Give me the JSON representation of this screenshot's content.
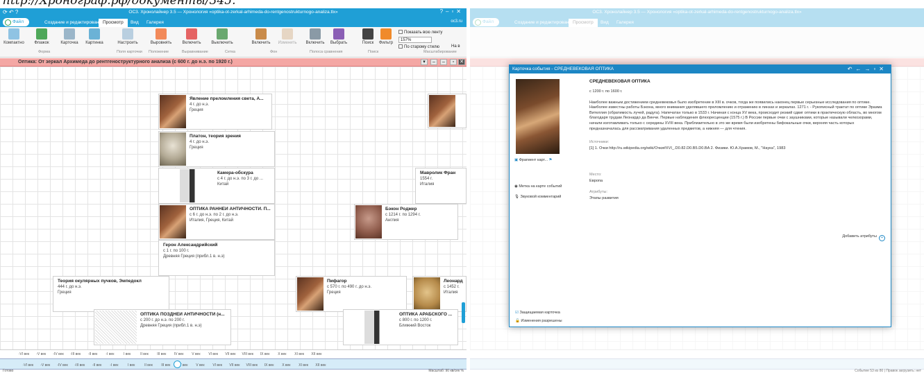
{
  "caption": "http://Хронограф.рф/документы/345.",
  "app": {
    "title": "ОС3. Хронолайнер 3.5 — Хронология «optika-ot-zerkal-arhimeda-do-rentgenostrukturnogo-analiza.tlx»",
    "site": "oc3.ru",
    "tabs": [
      "Файл",
      "Создание и редактирование",
      "Просмотр",
      "Вид",
      "Галерея"
    ],
    "active_tab": "Просмотр"
  },
  "ribbon": {
    "buttons": [
      "Компактно",
      "Флажок",
      "Карточка",
      "Картинка",
      "Настроить",
      "Выровнять",
      "Включить",
      "Выключить",
      "Включить",
      "Изменить",
      "Включить",
      "Выбрать",
      "Поиск",
      "Фильтр"
    ],
    "groups": [
      "Форма",
      "Поля карточки",
      "Положение",
      "Выравнивание",
      "Сетка",
      "Фон",
      "Полоса сравнения",
      "Поиск",
      "Масштабирование"
    ],
    "show_all_label": "Показать всю ленту",
    "zoom_value": "157%",
    "old_style_label": "По старому стилю",
    "to_label": "На в"
  },
  "timeline": {
    "title": "Оптика: От зеркал Архимеда до рентгеноструктурного анализа (с 600 г. до н.э. по 1920 г.)",
    "centuries": [
      "-VI век",
      "-V век",
      "-IV век",
      "-III век",
      "-II век",
      "-I век",
      "I век",
      "II век",
      "III век",
      "IV век",
      "V век",
      "VI век",
      "VII век",
      "VIII век",
      "IX век",
      "X век",
      "XI век",
      "XII век"
    ],
    "status_left": "Готово",
    "status_right": "Масштаб: 90 кв/сек %"
  },
  "cards": [
    {
      "title": "Явление преломления света, А...",
      "date": "4 г. до н.э.",
      "place": "Греция"
    },
    {
      "title": "Платон, теория зрения",
      "date": "4 г. до н.э.",
      "place": "Греция"
    },
    {
      "title": "Камера-обскура",
      "date": "с 4 г. до н.э. по 3 г. до ...",
      "place": "Китай"
    },
    {
      "title": "Мавролик Фран",
      "date": "1554 г.",
      "place": "Италия"
    },
    {
      "title": "ОПТИКА РАННЕЙ АНТИЧНОСТИ. П...",
      "date": "с 6 г. до н.э. по 2 г. до н.э.",
      "place": "Италия, Греция, Китай"
    },
    {
      "title": "Бэкон Роджер",
      "date": "с 1214 г. по 1294 г.",
      "place": "Англия"
    },
    {
      "title": "Герон Александрийский",
      "date": "с 1 г. по 100 г.",
      "place": "Древняя Греция (прибл.1 в. н.э)"
    },
    {
      "title": "Теория окулярных пучков, Эмпедокл",
      "date": "444 г. до н.э.",
      "place": "Греция"
    },
    {
      "title": "Пифагор",
      "date": "с 570 г. по 490 г. до н.э.",
      "place": "Греция"
    },
    {
      "title": "Леонард",
      "date": "с 1452 г.",
      "place": "Италия"
    },
    {
      "title": "ОПТИКА ПОЗДНЕЙ АНТИЧНОСТИ (н...",
      "date": "с 200 г. до н.э. по 200 г.",
      "place": "Древняя Греция (прибл.1 в. н.э)"
    },
    {
      "title": "ОПТИКА АРАБСКОГО ...",
      "date": "с 800 г. по 1200 г.",
      "place": "Ближний Восток"
    }
  ],
  "dialog": {
    "title": "Карточка события - СРЕДНЕВЕКОВАЯ ОПТИКА",
    "heading": "СРЕДНЕВЕКОВАЯ ОПТИКА",
    "dates": "с 1200 г. по 1600 г.",
    "body": "Наиболее важным достижением средневековья было изобретение в XIII в. очков, тогда же появились наконец первые серьезные исследования по оптике. Наиболее известны работы Бэкона, много внимания уделявшего преломлению и отражению в линзах и зеркалах. 1271 г. - Рукописный трактат по оптике Эразма Вителлия (обратимость лучей, радуга). Напечатан только в 1533 г. Начиная с конца XV века, происходит резкий сдвиг оптики в практическую область, во многом благодаря трудам Леонардо да Винчи. Первые наблюдения флюоресценции (1575 г.) В России первые очки с заушниками, которые называли челкозорами, начали изготавливать только с середины XVIII века. Приблизительно в это же время были изобретены бифокальные очки, верхняя часть которых предназначалась для рассматривания удаленных предметов, а нижняя — для чтения.",
    "sources_label": "Источники:",
    "source": "[1]   1. Очки http://ru.wikipedia.org/wiki/Очки#XVI_.D0.82.D0.B5.D0.BA 2. Физики. Ю.А.Храмов, М., \"Наука\", 1983",
    "place_label": "Место:",
    "place": "Европа",
    "attrs_label": "Атрибуты:",
    "attr_value": "Этапы развития",
    "add_attr": "Добавить атрибуты",
    "fragment": "Фрагмент карт...",
    "map_mark": "Метка на карте событий",
    "sound": "Звуковой комментарий",
    "protected": "Защищаемая карточка",
    "changes": "Изменения разрешены",
    "status_right": "Событие 53 из 80 | Правок загрузить: нет"
  }
}
